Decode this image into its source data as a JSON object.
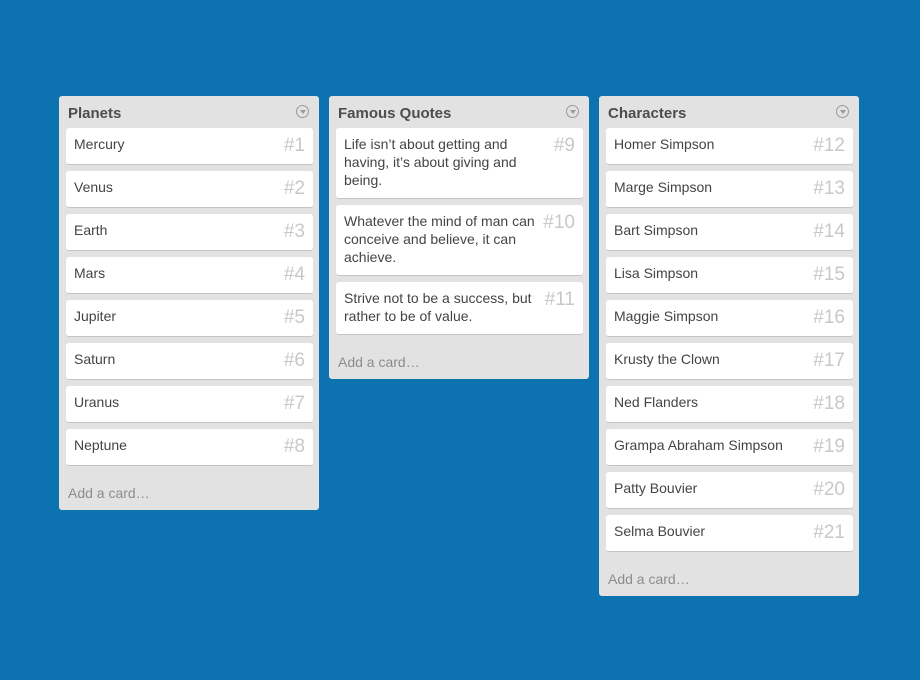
{
  "lists": [
    {
      "title": "Planets",
      "add_label": "Add a card…",
      "cards": [
        {
          "text": "Mercury",
          "num": "#1"
        },
        {
          "text": "Venus",
          "num": "#2"
        },
        {
          "text": "Earth",
          "num": "#3"
        },
        {
          "text": "Mars",
          "num": "#4"
        },
        {
          "text": "Jupiter",
          "num": "#5"
        },
        {
          "text": "Saturn",
          "num": "#6"
        },
        {
          "text": "Uranus",
          "num": "#7"
        },
        {
          "text": "Neptune",
          "num": "#8"
        }
      ]
    },
    {
      "title": "Famous Quotes",
      "add_label": "Add a card…",
      "cards": [
        {
          "text": "Life isn’t about getting and having, it’s about giving and being.",
          "num": "#9"
        },
        {
          "text": "Whatever the mind of man can conceive and believe, it can achieve.",
          "num": "#10"
        },
        {
          "text": "Strive not to be a success, but rather to be of value.",
          "num": "#11"
        }
      ]
    },
    {
      "title": "Characters",
      "add_label": "Add a card…",
      "cards": [
        {
          "text": "Homer Simpson",
          "num": "#12"
        },
        {
          "text": "Marge Simpson",
          "num": "#13"
        },
        {
          "text": "Bart Simpson",
          "num": "#14"
        },
        {
          "text": "Lisa Simpson",
          "num": "#15"
        },
        {
          "text": "Maggie Simpson",
          "num": "#16"
        },
        {
          "text": "Krusty the Clown",
          "num": "#17"
        },
        {
          "text": "Ned Flanders",
          "num": "#18"
        },
        {
          "text": "Grampa Abraham Simpson",
          "num": "#19"
        },
        {
          "text": "Patty Bouvier",
          "num": "#20"
        },
        {
          "text": "Selma Bouvier",
          "num": "#21"
        }
      ]
    }
  ],
  "icons": {
    "list_menu": "circle-chevron-down-icon"
  },
  "colors": {
    "background": "#0c73b0",
    "list": "#e2e2e2",
    "card": "#ffffff"
  }
}
